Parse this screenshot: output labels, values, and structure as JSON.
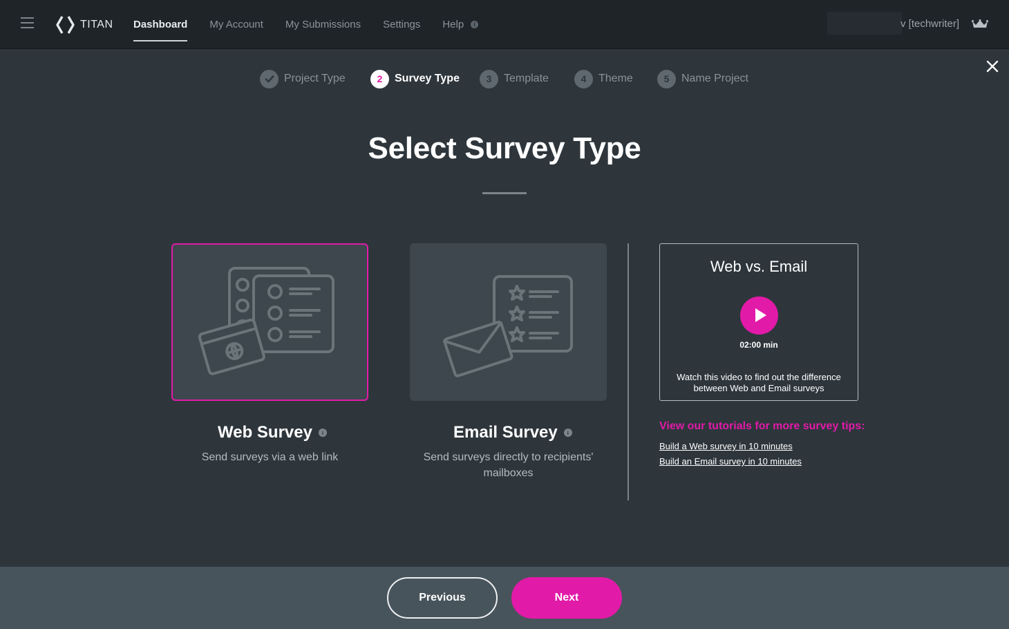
{
  "nav": {
    "brand": "TITAN",
    "items": [
      {
        "label": "Dashboard",
        "active": true
      },
      {
        "label": "My Account",
        "active": false
      },
      {
        "label": "My Submissions",
        "active": false
      },
      {
        "label": "Settings",
        "active": false
      },
      {
        "label": "Help",
        "active": false
      }
    ],
    "help_info_glyph": "i",
    "user_label": "v [techwriter]",
    "icons": {
      "menu": "hamburger-icon",
      "logo": "titan-logo-icon",
      "crown": "crown-icon",
      "info": "info-icon"
    }
  },
  "stepper": {
    "steps": [
      {
        "number": "1",
        "label": "Project Type",
        "state": "done"
      },
      {
        "number": "2",
        "label": "Survey Type",
        "state": "current"
      },
      {
        "number": "3",
        "label": "Template",
        "state": "upcoming"
      },
      {
        "number": "4",
        "label": "Theme",
        "state": "upcoming"
      },
      {
        "number": "5",
        "label": "Name Project",
        "state": "upcoming"
      }
    ],
    "close_icon": "close-icon"
  },
  "page": {
    "title": "Select Survey Type"
  },
  "options": [
    {
      "title": "Web Survey",
      "description": "Send surveys via a web link",
      "selected": true,
      "info_glyph": "i"
    },
    {
      "title": "Email Survey",
      "description": "Send surveys directly to recipients' mailboxes",
      "selected": false,
      "info_glyph": "i"
    }
  ],
  "video": {
    "title": "Web vs. Email",
    "duration": "02:00 min",
    "description": "Watch this video to find out the difference between Web and Email surveys"
  },
  "tips": {
    "heading": "View our tutorials for more survey tips:",
    "links": [
      "Build a Web survey in 10 minutes",
      "Build an Email survey in 10 minutes"
    ]
  },
  "footer": {
    "previous_label": "Previous",
    "next_label": "Next"
  },
  "colors": {
    "accent": "#e21aa8",
    "background": "#2e363c",
    "topbar": "#1f2428",
    "card": "#3d474d",
    "footer": "#48545b"
  }
}
